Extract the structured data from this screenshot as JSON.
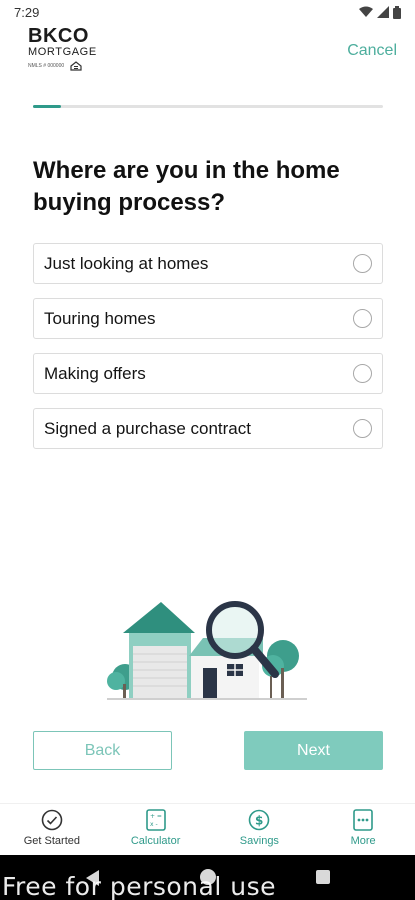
{
  "status_bar": {
    "time": "7:29"
  },
  "header": {
    "logo_main": "BKCO",
    "logo_sub": "MORTGAGE",
    "logo_nmls": "NMLS # 000000",
    "cancel_label": "Cancel"
  },
  "progress": {
    "fraction": 0.08,
    "color": "#2f9a8a"
  },
  "question": "Where are you in the home buying process?",
  "options": [
    {
      "label": "Just looking at homes"
    },
    {
      "label": "Touring homes"
    },
    {
      "label": "Making offers"
    },
    {
      "label": "Signed a purchase contract"
    }
  ],
  "buttons": {
    "back_label": "Back",
    "next_label": "Next"
  },
  "bottom_nav": [
    {
      "label": "Get Started",
      "icon": "check-circle-icon",
      "color": "#333333"
    },
    {
      "label": "Calculator",
      "icon": "calculator-icon",
      "color": "#2f9a8a"
    },
    {
      "label": "Savings",
      "icon": "dollar-circle-icon",
      "color": "#2f9a8a"
    },
    {
      "label": "More",
      "icon": "more-dots-icon",
      "color": "#2f9a8a"
    }
  ],
  "watermark": "Free for personal use",
  "colors": {
    "accent": "#4dae9d",
    "next_button": "#7fcbbd",
    "back_border": "#7cc5b8"
  }
}
